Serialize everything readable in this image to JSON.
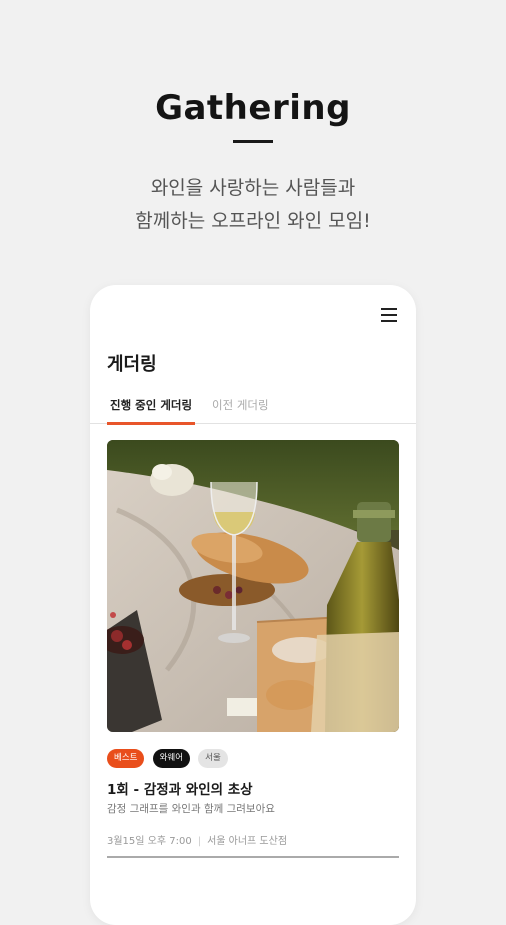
{
  "headline": "Gathering",
  "tagline_lines": [
    "와인을 사랑하는 사람들과",
    "함께하는 오프라인 와인 모임!"
  ],
  "app": {
    "menu_icon": "hamburger-menu-icon",
    "page_title": "게더링",
    "tabs": [
      {
        "label": "진행 중인 게더링",
        "active": true
      },
      {
        "label": "이전 게더링",
        "active": false
      }
    ],
    "accent_color": "#e8552a"
  },
  "event": {
    "image": "picnic-wine-photo",
    "tags": [
      "베스트",
      "와웨어",
      "서울"
    ],
    "title": "1회 - 감정과 와인의 초상",
    "description": "감정 그래프를 와인과 함께 그려보아요",
    "date": "3월15일 오후 7:00",
    "location": "서울 아너프 도산점"
  }
}
